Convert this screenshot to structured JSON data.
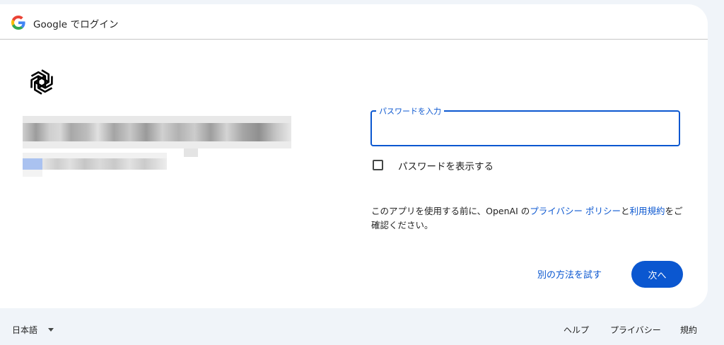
{
  "header": {
    "title": "Google でログイン",
    "logo_icon": "google-g-icon"
  },
  "app": {
    "logo_icon": "openai-logo-icon"
  },
  "account": {
    "name_redacted": true,
    "email_redacted": true
  },
  "password": {
    "label": "パスワードを入力",
    "value": ""
  },
  "show_password": {
    "label": "パスワードを表示する",
    "checked": false
  },
  "notice": {
    "prefix": "このアプリを使用する前に、OpenAI の",
    "privacy_link": "プライバシー ポリシー",
    "middle": "と",
    "terms_link": "利用規約",
    "suffix": "をご確認ください。"
  },
  "actions": {
    "try_another": "別の方法を試す",
    "next": "次へ"
  },
  "footer": {
    "language": "日本語",
    "help": "ヘルプ",
    "privacy": "プライバシー",
    "terms": "規約"
  },
  "colors": {
    "accent": "#0b57d0",
    "background": "#f0f4f9",
    "card": "#ffffff"
  }
}
